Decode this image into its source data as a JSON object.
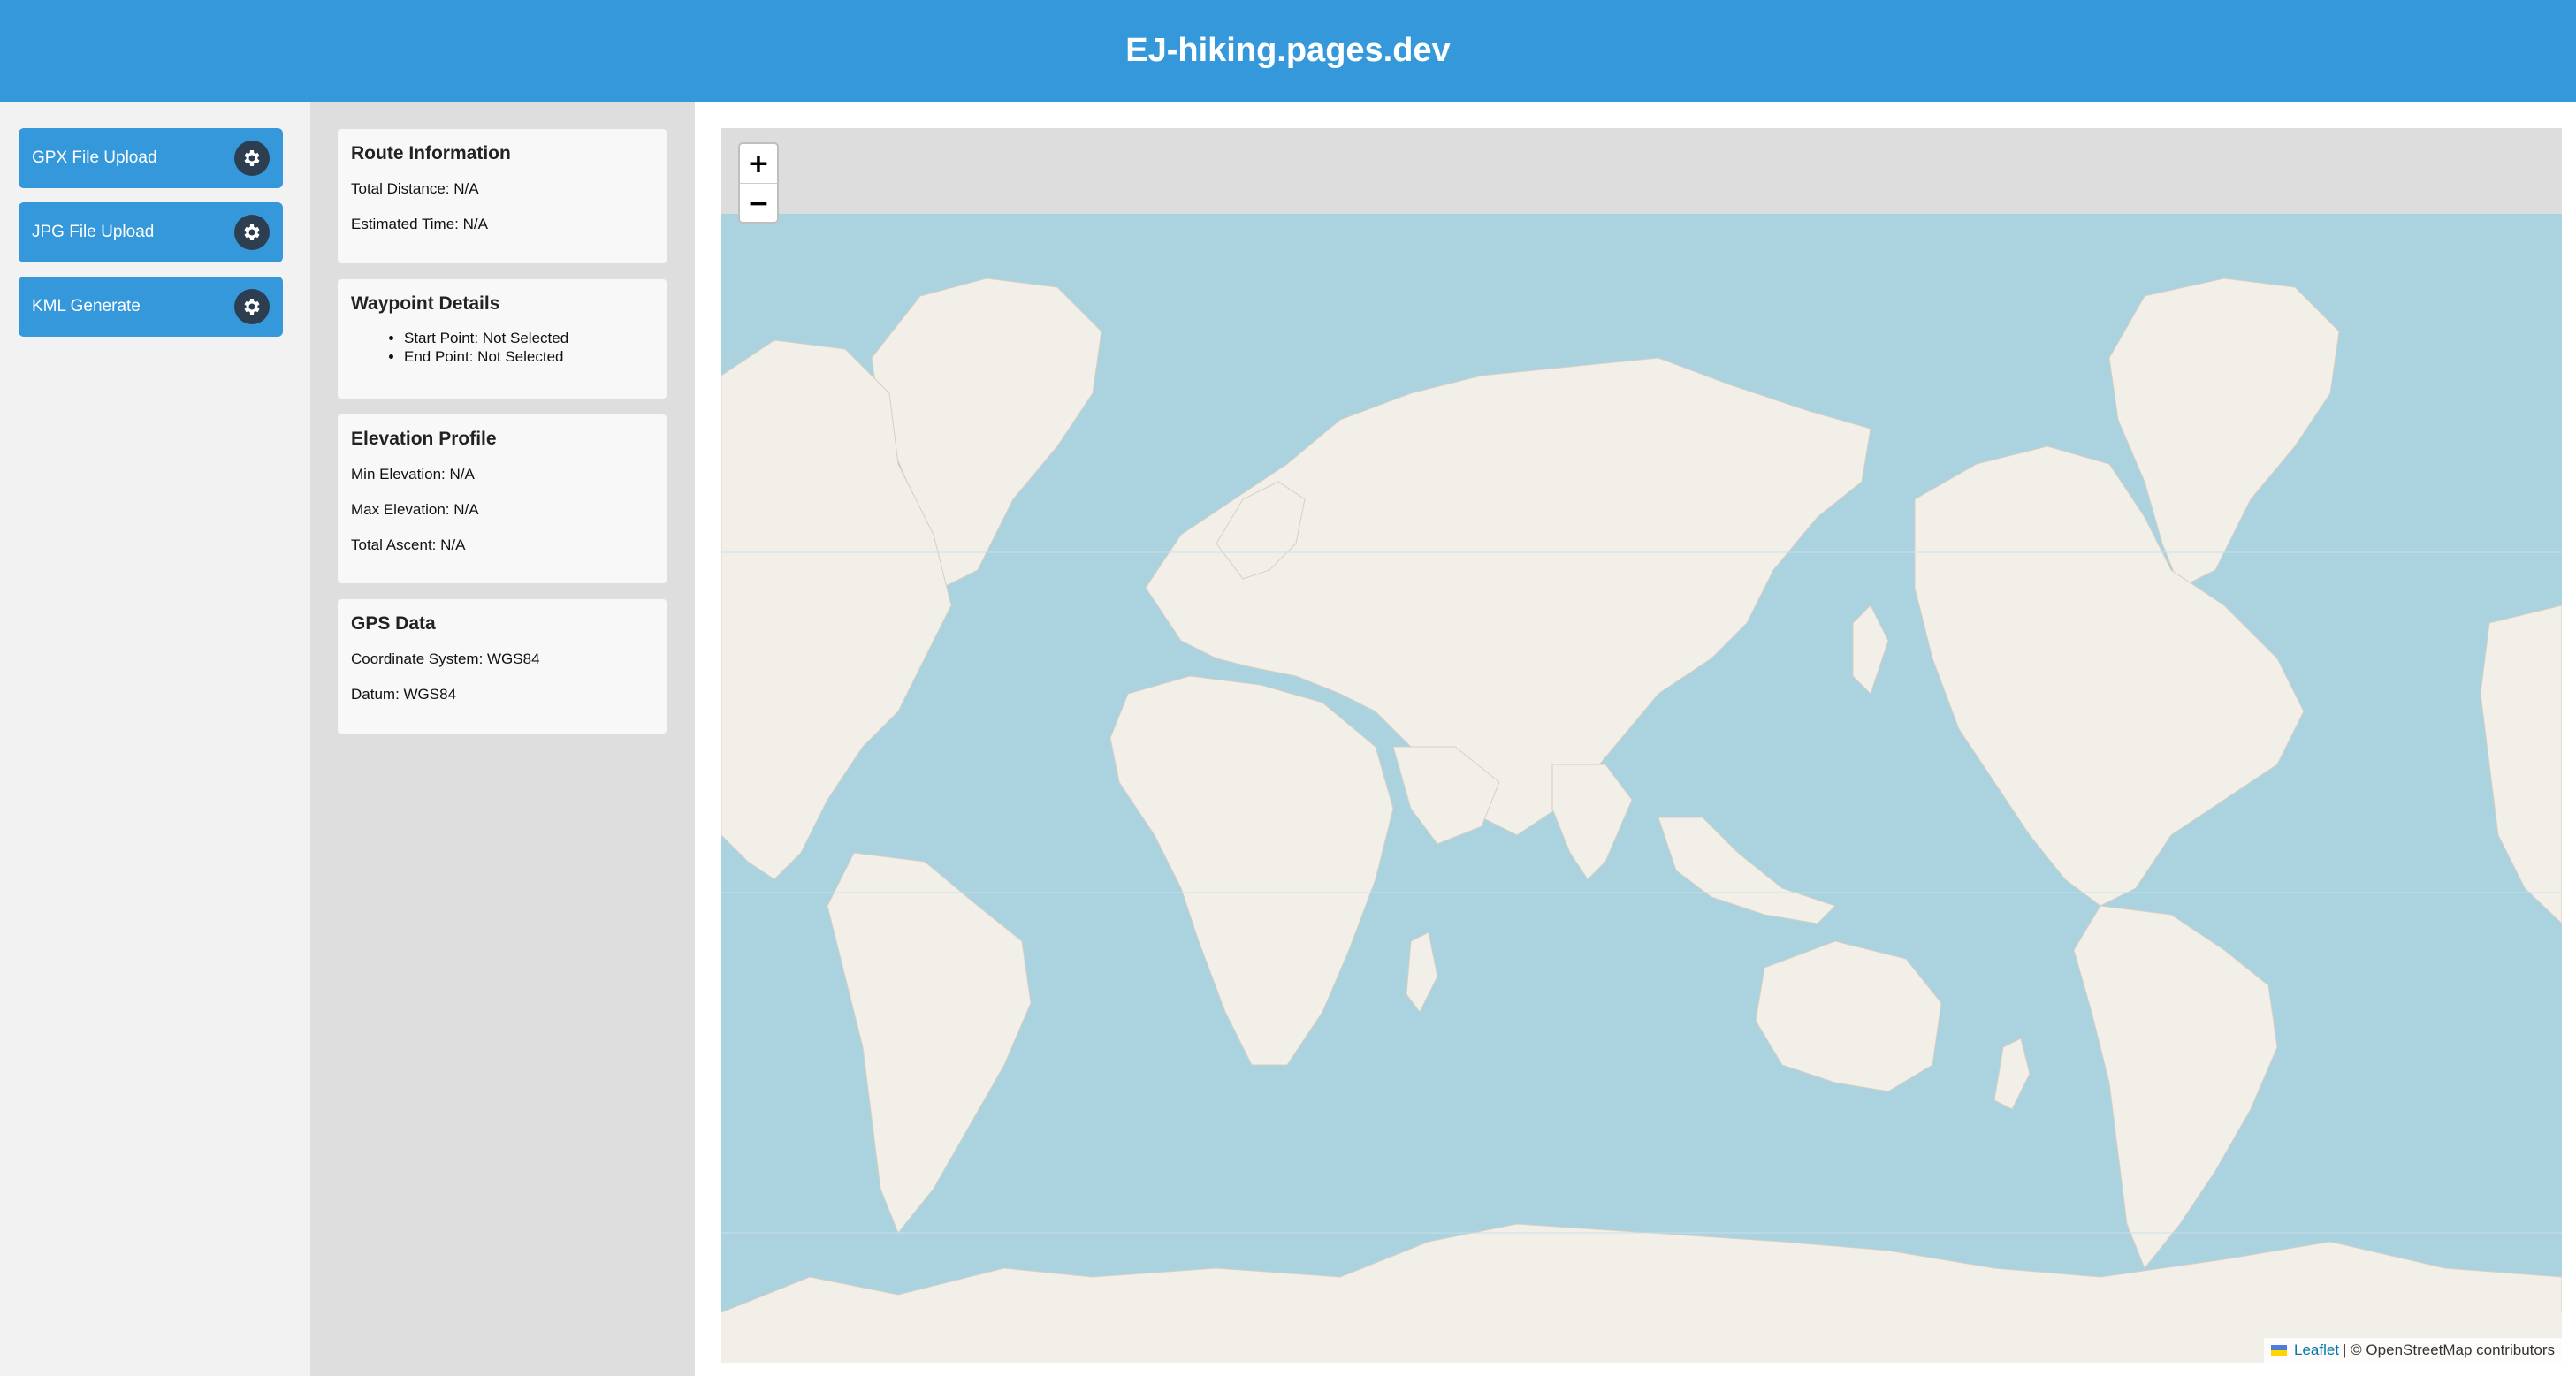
{
  "header": {
    "title": "EJ-hiking.pages.dev"
  },
  "tools": [
    {
      "label": "GPX File Upload",
      "icon": "gear-icon"
    },
    {
      "label": "JPG File Upload",
      "icon": "gear-icon"
    },
    {
      "label": "KML Generate",
      "icon": "gear-icon"
    }
  ],
  "route": {
    "title": "Route Information",
    "total_distance": "Total Distance: N/A",
    "estimated_time": "Estimated Time: N/A"
  },
  "waypoints": {
    "title": "Waypoint Details",
    "start": "Start Point: Not Selected",
    "end": "End Point: Not Selected"
  },
  "elevation": {
    "title": "Elevation Profile",
    "min": "Min Elevation: N/A",
    "max": "Max Elevation: N/A",
    "ascent": "Total Ascent: N/A"
  },
  "gps": {
    "title": "GPS Data",
    "coordinate_system": "Coordinate System: WGS84",
    "datum": "Datum: WGS84"
  },
  "map": {
    "zoom_in": "+",
    "zoom_out": "−",
    "attribution_link": "Leaflet",
    "attribution_text": "| © OpenStreetMap contributors",
    "ocean_color": "#aad3df",
    "land_color": "#f2efe9"
  },
  "colors": {
    "header": "#3498db",
    "button": "#3498db",
    "gear": "#2c3e50"
  }
}
